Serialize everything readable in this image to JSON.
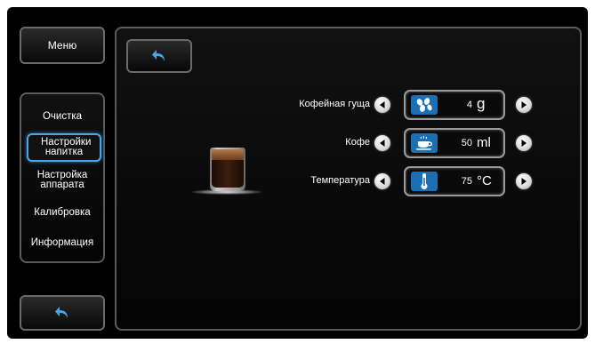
{
  "nav": {
    "menu_label": "Меню",
    "items": [
      {
        "label": "Очистка"
      },
      {
        "label": "Настройки напитка"
      },
      {
        "label": "Настройка аппарата"
      },
      {
        "label": "Калибровка"
      },
      {
        "label": "Информация"
      }
    ],
    "selected": "Настройки напитка"
  },
  "settings": [
    {
      "label": "Кофейная гуща",
      "value": "4",
      "unit": "g",
      "icon": "coffee-beans-icon"
    },
    {
      "label": "Кофе",
      "value": "50",
      "unit": "ml",
      "icon": "coffee-cup-icon"
    },
    {
      "label": "Температура",
      "value": "75",
      "unit": "°C",
      "icon": "thermometer-icon"
    }
  ],
  "icons": {
    "back": "back-arrow-icon",
    "decrease": "arrow-left-icon",
    "increase": "arrow-right-icon",
    "drink_image": "espresso-glass-image"
  },
  "colors": {
    "accent": "#49a6e6",
    "icon_bg": "#1c6fb2",
    "background": "#000000"
  }
}
